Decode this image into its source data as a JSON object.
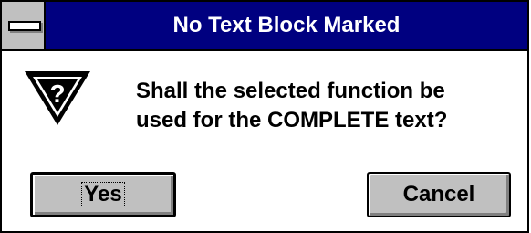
{
  "dialog": {
    "title": "No Text Block Marked",
    "message_lines": [
      "Shall the selected function be",
      "used for the COMPLETE text?"
    ],
    "icon": "question-warning-icon",
    "buttons": {
      "yes_label": "Yes",
      "cancel_label": "Cancel"
    }
  },
  "colors": {
    "titlebar": "#000080",
    "button_face": "#c0c0c0"
  }
}
